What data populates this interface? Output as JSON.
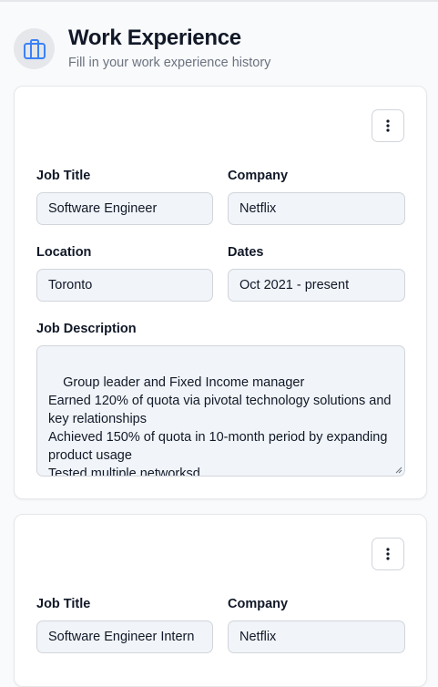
{
  "header": {
    "title": "Work Experience",
    "subtitle": "Fill in your work experience history",
    "icon": "briefcase-icon",
    "icon_color": "#3b82f6"
  },
  "labels": {
    "job_title": "Job Title",
    "company": "Company",
    "location": "Location",
    "dates": "Dates",
    "job_description": "Job Description"
  },
  "experiences": [
    {
      "job_title": "Software Engineer",
      "company": "Netflix",
      "location": "Toronto",
      "dates": "Oct 2021 - present",
      "description": "Group leader and Fixed Income manager\nEarned 120% of quota via pivotal technology solutions and key relationships\nAchieved 150% of quota in 10-month period by expanding product usage\nTested multiple networksd"
    },
    {
      "job_title": "Software Engineer Intern",
      "company": "Netflix"
    }
  ]
}
